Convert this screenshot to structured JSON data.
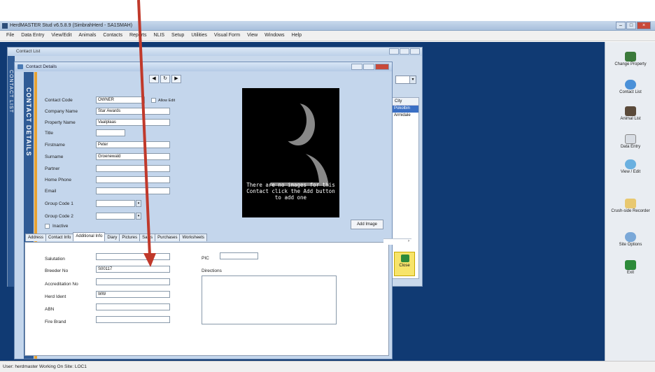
{
  "window": {
    "title": "HerdMASTER Stud v6.5.8.9 (SimbrahHerd - SA1SMAH)",
    "menu": [
      "File",
      "Data Entry",
      "View/Edit",
      "Animals",
      "Contacts",
      "Reports",
      "NLIS",
      "Setup",
      "Utilities",
      "Visual Form",
      "View",
      "Windows",
      "Help"
    ]
  },
  "contact_list": {
    "title": "Contact List",
    "side_label": "CONTACT LIST",
    "grid_header": "City",
    "rows": [
      "Pokolbin",
      "Armidale"
    ],
    "close_label": "Close"
  },
  "contact_details": {
    "title": "Contact Details",
    "side_label": "CONTACT DETAILS",
    "allow_edit_label": "Allow Edit",
    "fields": {
      "contact_code": {
        "label": "Contact Code",
        "value": "OWNER"
      },
      "company_name": {
        "label": "Company Name",
        "value": "Star Awards"
      },
      "property_name": {
        "label": "Property Name",
        "value": "Vaalplaas"
      },
      "title": {
        "label": "Title",
        "value": ""
      },
      "firstname": {
        "label": "Firstname",
        "value": "Peter"
      },
      "surname": {
        "label": "Surname",
        "value": "Groenewald"
      },
      "partner": {
        "label": "Partner",
        "value": ""
      },
      "home_phone": {
        "label": "Home Phone",
        "value": ""
      },
      "email": {
        "label": "Email",
        "value": ""
      },
      "group_code_1": {
        "label": "Group Code 1",
        "value": ""
      },
      "group_code_2": {
        "label": "Group Code 2",
        "value": ""
      },
      "inactive": {
        "label": "Inactive"
      }
    },
    "photo_text": "There are no images for this Contact click the Add button to add one",
    "add_image_label": "Add Image",
    "tabs": [
      "Address",
      "Contact Info",
      "Additional Info",
      "Diary",
      "Pictures",
      "Sales",
      "Purchases",
      "Worksheets"
    ],
    "active_tab": "Additional Info",
    "additional": {
      "salutation": {
        "label": "Salutation",
        "value": ""
      },
      "breeder_no": {
        "label": "Breeder No",
        "value": "S00117"
      },
      "accreditation_no": {
        "label": "Accreditation No",
        "value": ""
      },
      "herd_ident": {
        "label": "Herd Ident",
        "value": "WW"
      },
      "abn": {
        "label": "ABN",
        "value": ""
      },
      "fire_brand": {
        "label": "Fire Brand",
        "value": ""
      },
      "pic": {
        "label": "PIC",
        "value": ""
      },
      "directions": {
        "label": "Directions",
        "value": ""
      }
    }
  },
  "toolbar": {
    "items": [
      "Change Property",
      "Contact List",
      "Animal List",
      "Data Entry",
      "View / Edit",
      "Crush-side Recorder",
      "Site Options",
      "Exit"
    ]
  },
  "status": {
    "text": "User: herdmaster  Working On Site: LOC1"
  }
}
